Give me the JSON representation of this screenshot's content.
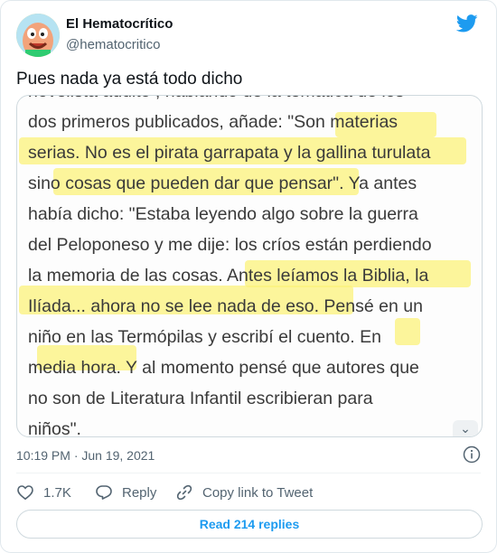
{
  "author": {
    "name": "El Hematocrítico",
    "handle": "@hematocritico"
  },
  "tweet": {
    "text": "Pues nada ya está todo dicho",
    "timestamp": "10:19 PM · Jun 19, 2021"
  },
  "media": {
    "lines": [
      "novelista adulto , hablando de la temática de los",
      "dos primeros publicados, añade: \"Son materias",
      "serias. No es el pirata garrapata y la gallina turulata",
      "sino cosas que pueden dar que pensar\". Ya antes",
      "había dicho: \"Estaba leyendo algo sobre la guerra",
      "del Peloponeso y me dije: los críos están perdiendo",
      "la memoria de las cosas. Antes leíamos la Biblia, la",
      "Ilíada... ahora no se lee nada de eso. Pensé en un",
      "niño en las Termópilas y escribí el cuento. En",
      "media hora. Y al momento pensé que autores que",
      "no son de Literatura Infantil escribieran para",
      "niños\"."
    ],
    "highlight_color": "#fbf27a"
  },
  "actions": {
    "likes_count": "1.7K",
    "reply_label": "Reply",
    "copy_link_label": "Copy link to Tweet"
  },
  "replies_button": "Read 214 replies",
  "colors": {
    "twitter_blue": "#1d9bf0",
    "muted": "#536471",
    "border": "#cfd9de"
  },
  "icons": [
    "twitter-bird-icon",
    "info-icon",
    "heart-icon",
    "reply-icon",
    "link-icon",
    "chevron-down-icon"
  ]
}
